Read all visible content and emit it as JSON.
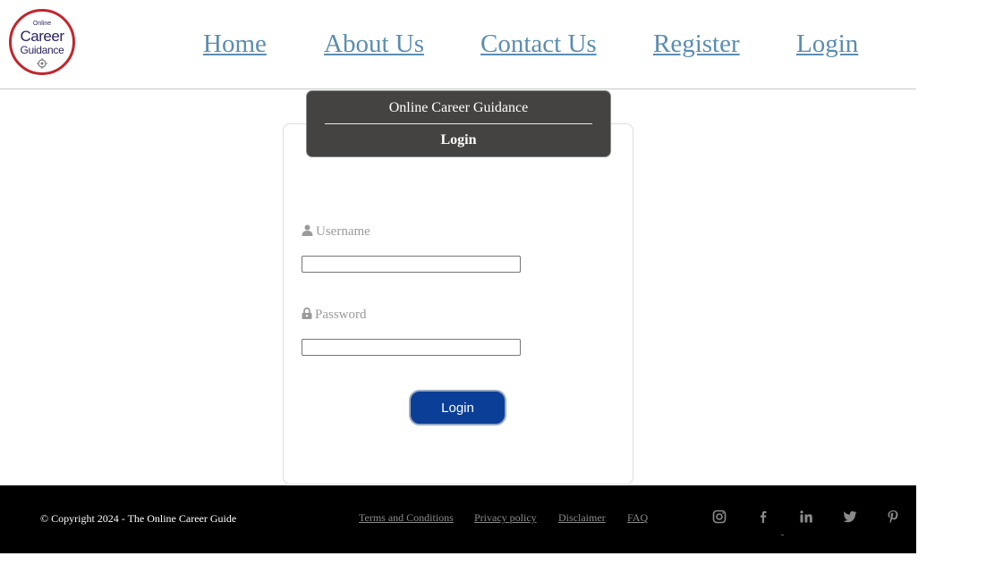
{
  "logo": {
    "line1": "Online",
    "line2": "Career",
    "line3": "Guidance"
  },
  "nav": {
    "home": "Home",
    "about": "About Us",
    "contact": "Contact Us",
    "register": "Register",
    "login": "Login"
  },
  "login_card": {
    "title": "Online Career Guidance",
    "subtitle": "Login",
    "username_label": "Username",
    "username_value": "",
    "password_label": "Password",
    "password_value": "",
    "submit_label": "Login"
  },
  "footer": {
    "copyright": "© Copyright 2024 - The Online Career Guide",
    "links": {
      "terms": "Terms and Conditions",
      "privacy": "Privacy policy",
      "disclaimer": "Disclaimer",
      "faq": "FAQ"
    },
    "social_icons": [
      "instagram-icon",
      "facebook-icon",
      "linkedin-icon",
      "twitter-icon",
      "pinterest-icon"
    ]
  },
  "colors": {
    "nav_link": "#5b8db0",
    "card_header": "#454341",
    "button": "#0b3e96",
    "footer_bg": "#000000",
    "logo_ring": "#c0272d"
  }
}
